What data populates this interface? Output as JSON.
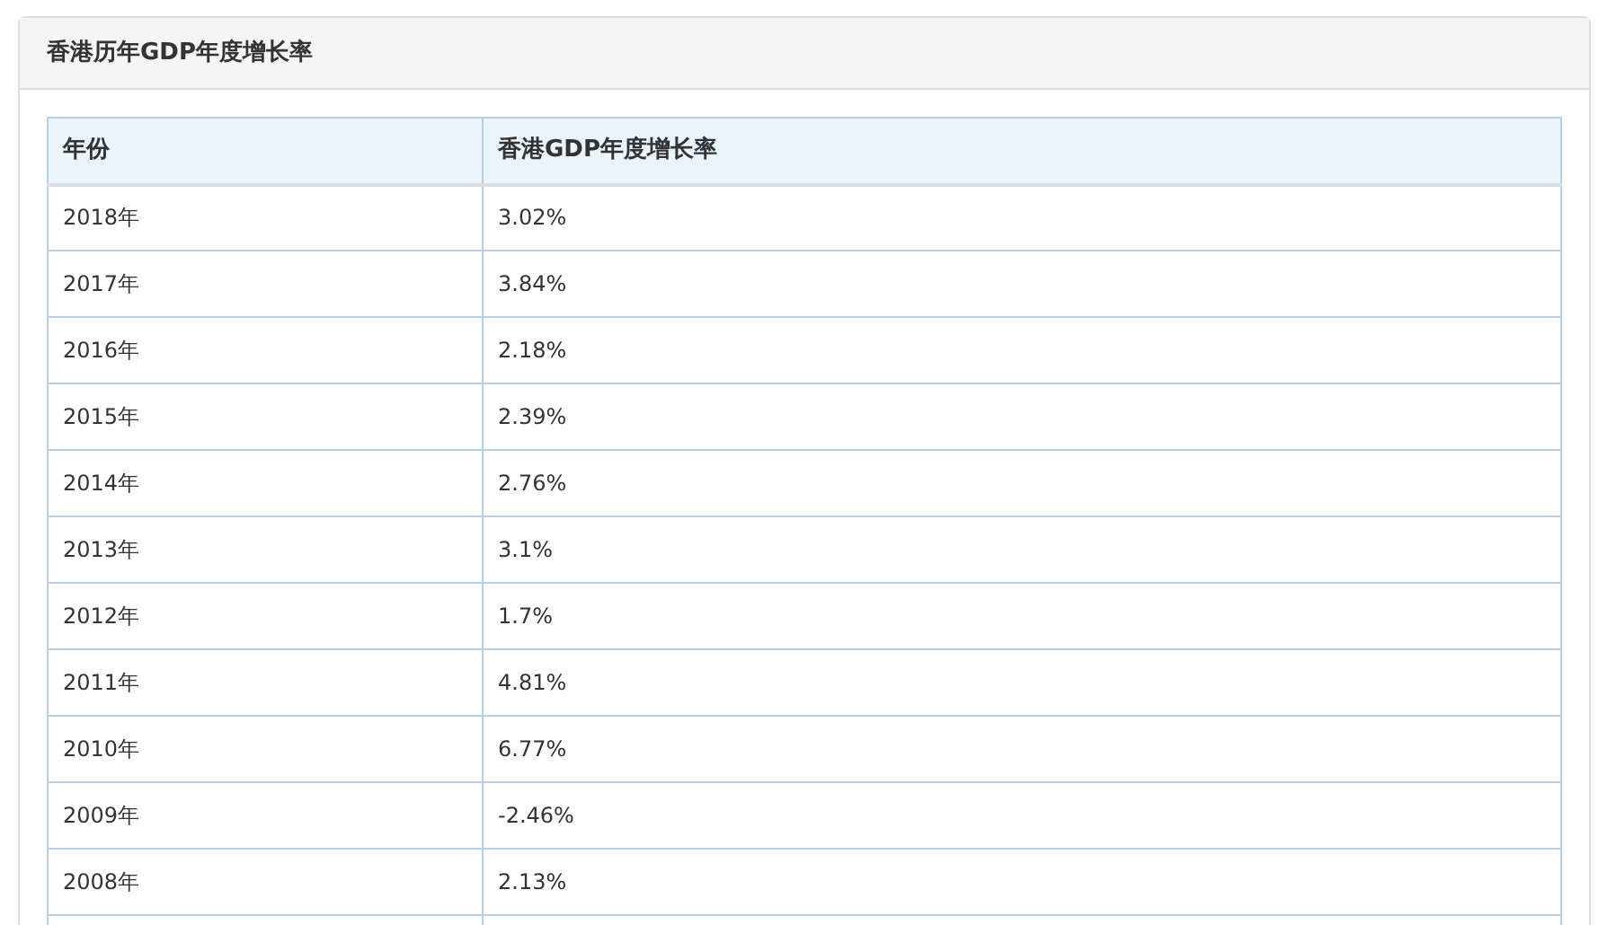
{
  "panel": {
    "title": "香港历年GDP年度增长率"
  },
  "table": {
    "columns": [
      "年份",
      "香港GDP年度增长率"
    ],
    "rows": [
      [
        "2018年",
        "3.02%"
      ],
      [
        "2017年",
        "3.84%"
      ],
      [
        "2016年",
        "2.18%"
      ],
      [
        "2015年",
        "2.39%"
      ],
      [
        "2014年",
        "2.76%"
      ],
      [
        "2013年",
        "3.1%"
      ],
      [
        "2012年",
        "1.7%"
      ],
      [
        "2011年",
        "4.81%"
      ],
      [
        "2010年",
        "6.77%"
      ],
      [
        "2009年",
        "-2.46%"
      ],
      [
        "2008年",
        "2.13%"
      ]
    ]
  }
}
